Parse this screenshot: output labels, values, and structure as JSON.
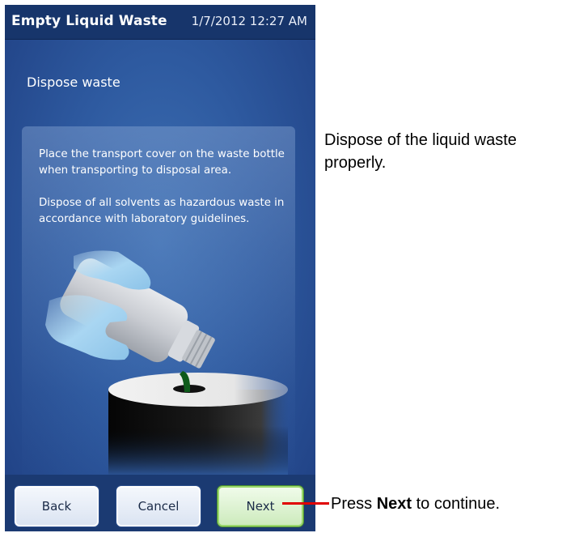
{
  "titlebar": {
    "title": "Empty Liquid Waste",
    "datetime": "1/7/2012 12:27 AM"
  },
  "screen": {
    "subtitle": "Dispose waste",
    "instructions": [
      "Place the transport cover on the waste bottle when transporting to disposal area.",
      "Dispose of all solvents as hazardous waste in accordance with laboratory guidelines."
    ]
  },
  "buttons": {
    "back": "Back",
    "cancel": "Cancel",
    "next": "Next"
  },
  "callouts": {
    "dispose": "Dispose of the liquid waste properly.",
    "press_prefix": "Press ",
    "press_bold": "Next",
    "press_suffix": " to continue."
  },
  "colors": {
    "titlebar": "#17356b",
    "screen": "#2e5aa0",
    "next_border": "#9ad86b",
    "leader": "#e00000"
  }
}
